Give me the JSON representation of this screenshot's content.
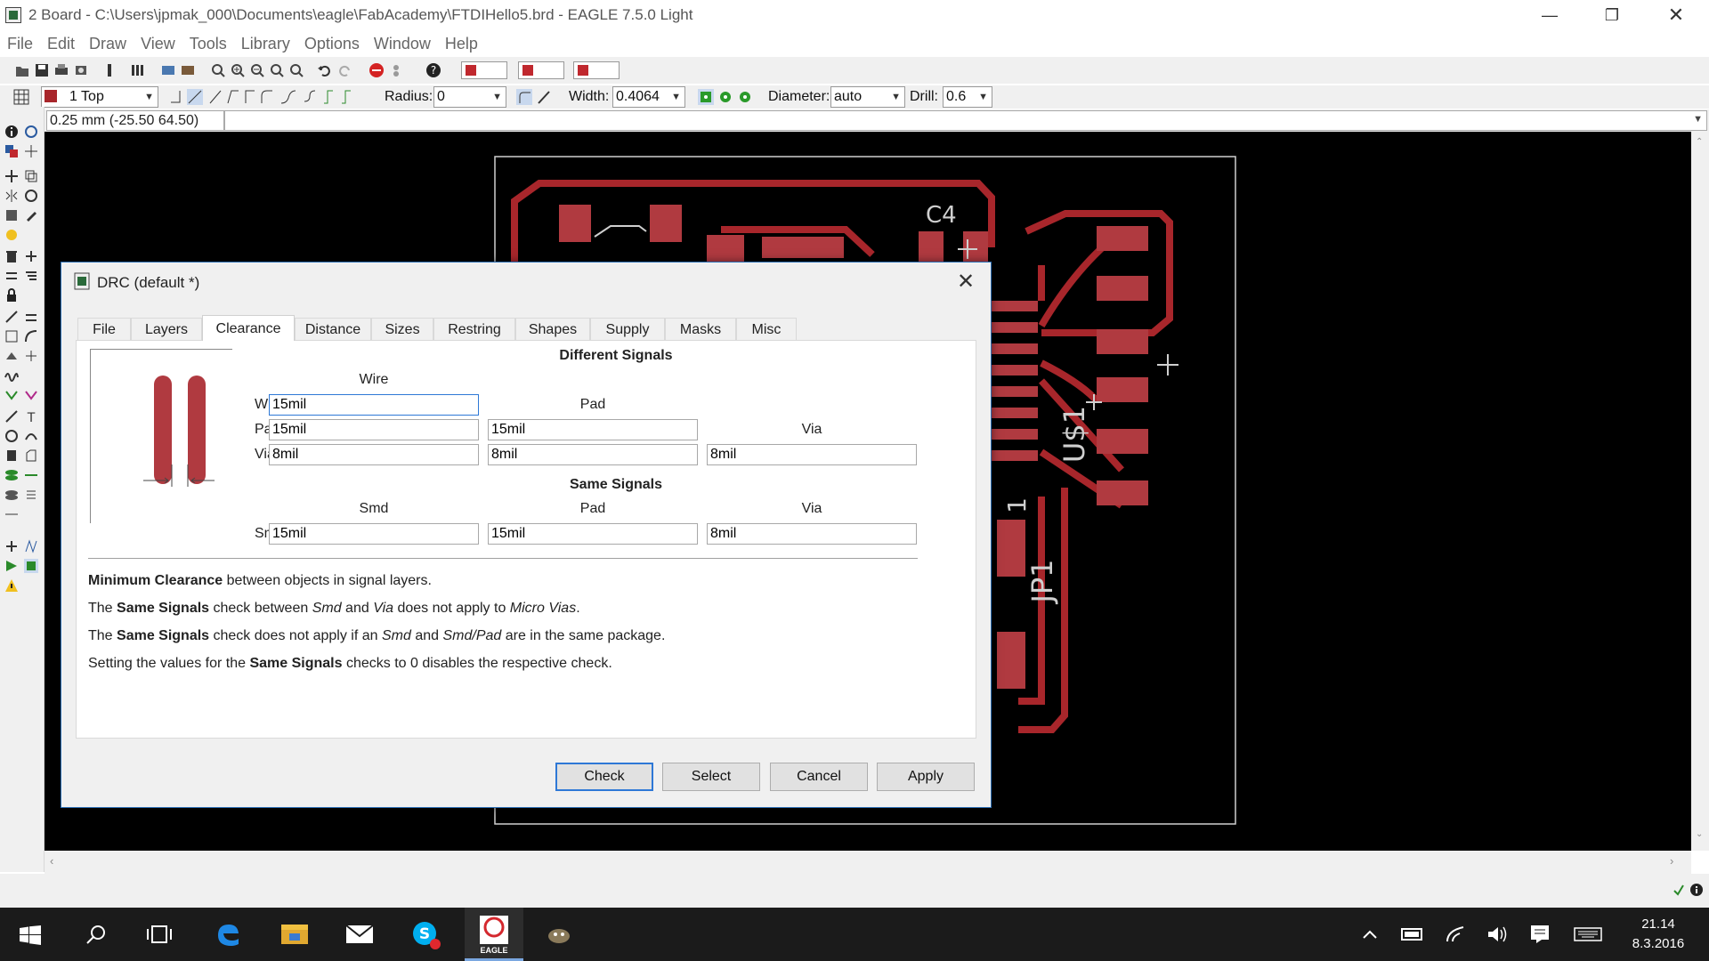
{
  "window": {
    "title": "2 Board - C:\\Users\\jpmak_000\\Documents\\eagle\\FabAcademy\\FTDIHello5.brd - EAGLE 7.5.0 Light",
    "controls": [
      "minimize",
      "restore",
      "close"
    ]
  },
  "menu": [
    "File",
    "Edit",
    "Draw",
    "View",
    "Tools",
    "Library",
    "Options",
    "Window",
    "Help"
  ],
  "toolbar2": {
    "layer": "1 Top",
    "radius_label": "Radius:",
    "radius_value": "0",
    "width_label": "Width:",
    "width_value": "0.4064",
    "diameter_label": "Diameter:",
    "diameter_value": "auto",
    "drill_label": "Drill:",
    "drill_value": "0.6"
  },
  "coordinate_display": "0.25 mm (-25.50 64.50)",
  "board": {
    "labels": [
      "C4",
      "U$1",
      "JP1",
      "1"
    ]
  },
  "dialog": {
    "title": "DRC (default *)",
    "tabs": [
      "File",
      "Layers",
      "Clearance",
      "Distance",
      "Sizes",
      "Restring",
      "Shapes",
      "Supply",
      "Masks",
      "Misc"
    ],
    "active_tab": "Clearance",
    "different_signals": {
      "heading": "Different Signals",
      "col_wire": "Wire",
      "col_pad": "Pad",
      "col_via": "Via",
      "row_wire": "Wire",
      "row_pad": "Pad",
      "row_via": "Via",
      "wire_wire": "15mil",
      "pad_wire": "15mil",
      "pad_pad": "15mil",
      "via_wire": "8mil",
      "via_pad": "8mil",
      "via_via": "8mil"
    },
    "same_signals": {
      "heading": "Same Signals",
      "col_smd": "Smd",
      "col_pad": "Pad",
      "col_via": "Via",
      "row_smd": "Smd",
      "smd_smd": "15mil",
      "smd_pad": "15mil",
      "smd_via": "8mil"
    },
    "info": {
      "l1_b": "Minimum Clearance",
      "l1_t": " between objects in signal layers.",
      "l2_a": "The ",
      "l2_b": "Same Signals",
      "l2_c": " check between ",
      "l2_d": "Smd",
      "l2_e": " and ",
      "l2_f": "Via",
      "l2_g": " does not apply to ",
      "l2_h": "Micro Vias",
      "l2_i": ".",
      "l3_a": "The ",
      "l3_b": "Same Signals",
      "l3_c": " check does not apply if an ",
      "l3_d": "Smd",
      "l3_e": " and ",
      "l3_f": "Smd/Pad",
      "l3_g": " are in the same package.",
      "l4_a": "Setting the values for the ",
      "l4_b": "Same Signals",
      "l4_c": " checks to 0 disables the respective check."
    },
    "buttons": {
      "check": "Check",
      "select": "Select",
      "cancel": "Cancel",
      "apply": "Apply"
    }
  },
  "taskbar": {
    "time": "21.14",
    "date": "8.3.2016",
    "active_app_label": "EAGLE"
  },
  "colors": {
    "trace": "#a8262b",
    "pad": "#b03a40",
    "canvas": "#000000",
    "accent": "#2e78d6"
  }
}
